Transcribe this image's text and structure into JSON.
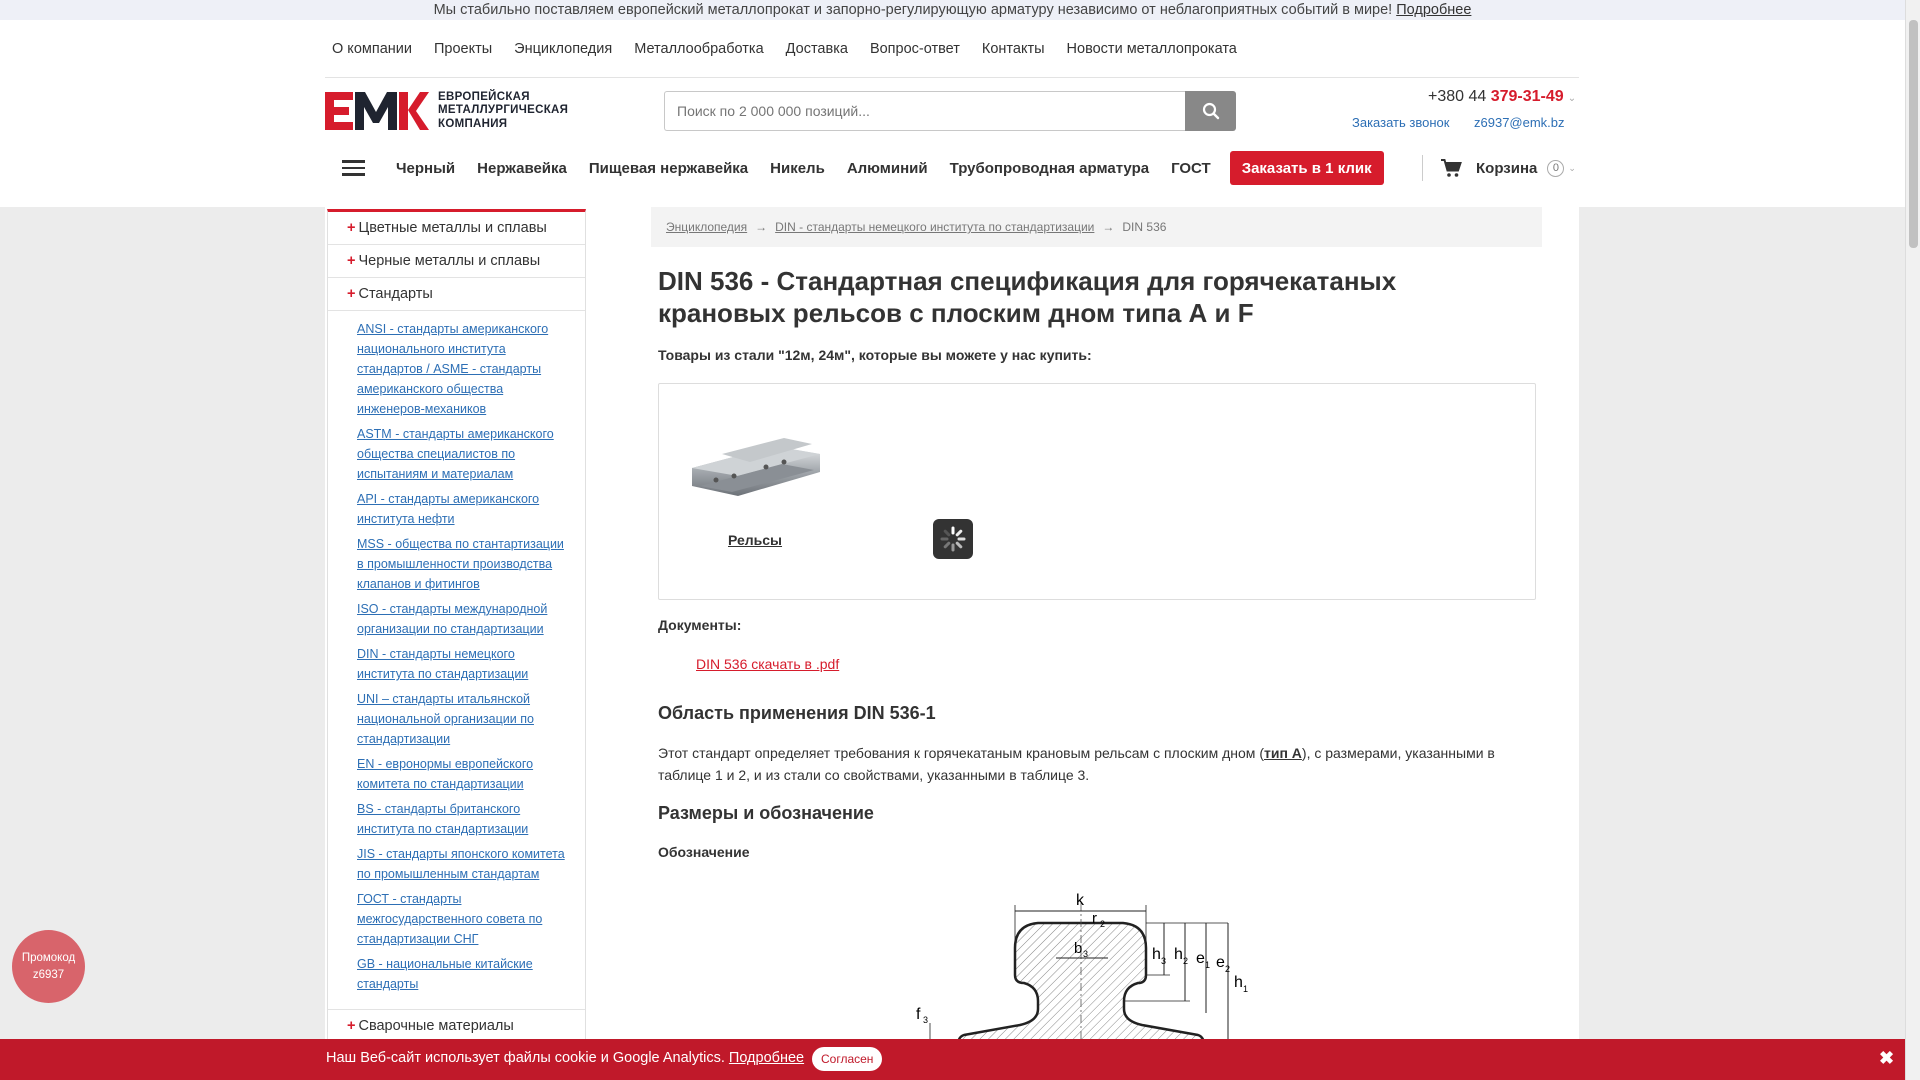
{
  "announcement": {
    "text": "Мы стабильно поставляем европейский металлопрокат и запорно-регулирующую арматуру независимо от неблагоприятных событий в мире!",
    "link": "Подробнее"
  },
  "top_nav": [
    "О компании",
    "Проекты",
    "Энциклопедия",
    "Металлообработка",
    "Доставка",
    "Вопрос-ответ",
    "Контакты",
    "Новости металлопроката"
  ],
  "logo": {
    "mark": "EMK",
    "line1": "ЕВРОПЕЙСКАЯ",
    "line2": "МЕТАЛЛУРГИЧЕСКАЯ",
    "line3": "КОМПАНИЯ"
  },
  "search": {
    "placeholder": "Поиск по 2 000 000 позиций..."
  },
  "contacts": {
    "phone_prefix": "+380 44",
    "phone_number": "379-31-49",
    "callback": "Заказать звонок",
    "email": "z6937@emk.bz"
  },
  "categories": [
    "Черный",
    "Нержавейка",
    "Пищевая нержавейка",
    "Никель",
    "Алюминий",
    "Трубопроводная арматура",
    "ГОСТ"
  ],
  "order_button": "Заказать в 1 клик",
  "cart": {
    "label": "Корзина",
    "count": "0"
  },
  "sidebar": {
    "items": [
      {
        "plus": "+",
        "label": "Цветные металлы и сплавы"
      },
      {
        "plus": "+",
        "label": "Черные металлы и сплавы"
      },
      {
        "plus": "+",
        "label": "Стандарты"
      }
    ],
    "standards": [
      "ANSI - стандарты американского национального института стандартов / ASME - стандарты американского общества инженеров-механиков",
      "ASTM - стандарты американского общества специалистов по испытаниям и материалам",
      "API - стандарты американского института нефти",
      "MSS - общества по стантартизации в промышленности производства клапанов и фитингов",
      "ISO - стандарты международной организации по стандартизации",
      "DIN - стандарты немецкого института по стандартизации",
      "UNI – стандарты итальянской национальной организации по стандартизации",
      "EN - евронормы европейского комитета по стандартизации",
      "BS - стандарты британского института по стандартизации",
      "JIS - стандарты японского комитета по промышленным стандартам",
      "ГОСТ - стандарты межгосударственного совета по стандартизации СНГ",
      "GB - национальные китайские стандарты"
    ],
    "last_item": {
      "plus": "+",
      "label": "Сварочные материалы"
    }
  },
  "breadcrumb": {
    "items": [
      "Энциклопедия",
      "DIN - стандарты немецкого института по стандартизации"
    ],
    "current": "DIN 536",
    "arrow": "→"
  },
  "page": {
    "title": "DIN 536 - Стандартная спецификация для горячекатаных крановых рельсов с плоским дном типа А и F",
    "subtitle": "Товары из стали \"12м, 24м\", которые вы можете у нас купить:",
    "product_name": "Рельсы",
    "docs_label": "Документы:",
    "pdf_link": "DIN 536 скачать в .pdf",
    "scope_heading": "Область применения DIN 536-1",
    "scope_text_before": "Этот стандарт определяет требования к горячекатаным крановым рельсам с плоским дном (",
    "scope_text_link": "тип А",
    "scope_text_after": "), с размерами, указанными в таблице 1 и 2, и из стали со свойствами, указанными в таблице 3.",
    "sizes_heading": "Размеры и обозначение",
    "designation": "Обозначение"
  },
  "diagram_labels": {
    "k": "k",
    "r2": "r",
    "r2_sub": "2",
    "b3": "b",
    "b3_sub": "3",
    "h3": "h",
    "h3_sub": "3",
    "h2": "h",
    "h2_sub": "2",
    "e1": "e",
    "e1_sub": "1",
    "e2": "e",
    "e2_sub": "2",
    "h1": "h",
    "h1_sub": "1",
    "f3": "f",
    "f3_sub": "3"
  },
  "promo": {
    "line1": "Промокод",
    "line2": "z6937"
  },
  "cookie": {
    "text": "Наш Веб-сайт использует файлы cookie и Google Analytics.",
    "link": "Подробнее",
    "agree": "Согласен",
    "close": "✖"
  },
  "colors": {
    "accent": "#d61c2c",
    "link": "#2d6fb5",
    "cookie_bar": "#c0192a"
  }
}
